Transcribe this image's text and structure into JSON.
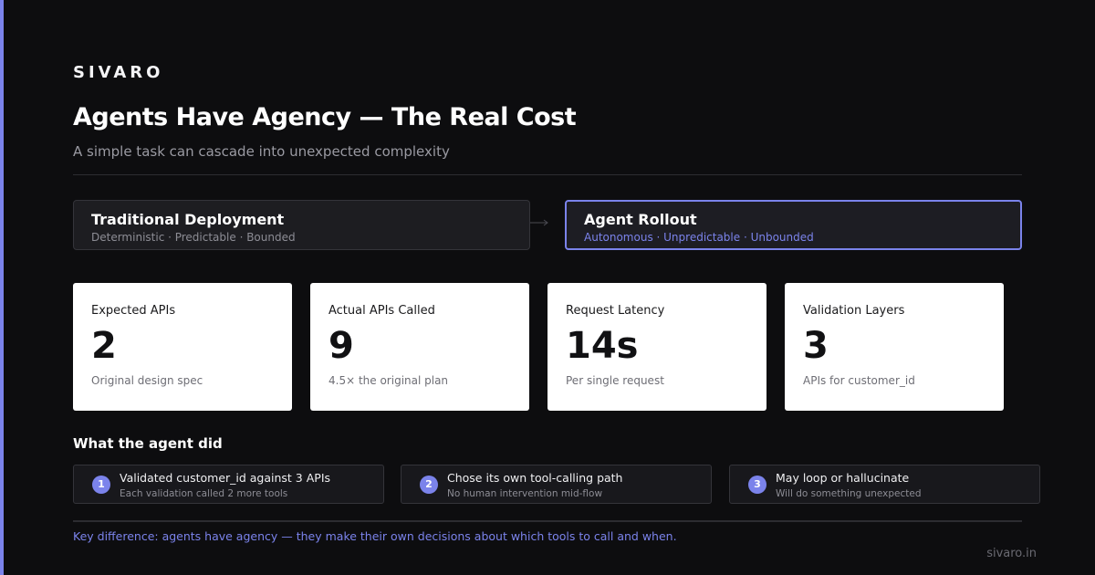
{
  "brand": "SIVARO",
  "title": "Agents Have Agency — The Real Cost",
  "subtitle": "A simple task can cascade into unexpected complexity",
  "comparison": {
    "traditional": {
      "name": "Traditional Deployment",
      "tags": "Deterministic · Predictable · Bounded"
    },
    "agent": {
      "name": "Agent Rollout",
      "tags": "Autonomous · Unpredictable · Unbounded"
    }
  },
  "stats": [
    {
      "label": "Expected APIs",
      "value": "2",
      "sub": "Original design spec"
    },
    {
      "label": "Actual APIs Called",
      "value": "9",
      "sub": "4.5× the original plan"
    },
    {
      "label": "Request Latency",
      "value": "14s",
      "sub": "Per single request"
    },
    {
      "label": "Validation Layers",
      "value": "3",
      "sub": "APIs for customer_id"
    }
  ],
  "section_title": "What the agent did",
  "steps": [
    {
      "num": "1",
      "main": "Validated customer_id against 3 APIs",
      "detail": "Each validation called 2 more tools"
    },
    {
      "num": "2",
      "main": "Chose its own tool-calling path",
      "detail": "No human intervention mid-flow"
    },
    {
      "num": "3",
      "main": "May loop or hallucinate",
      "detail": "Will do something unexpected"
    }
  ],
  "footnote": "Key difference: agents have agency — they make their own decisions about which tools to call and when.",
  "site": "sivaro.in",
  "colors": {
    "accent": "#7b83eb",
    "background": "#0d0d0f",
    "card": "#ffffff"
  },
  "icons": {
    "arrow": "arrow-right-icon"
  }
}
